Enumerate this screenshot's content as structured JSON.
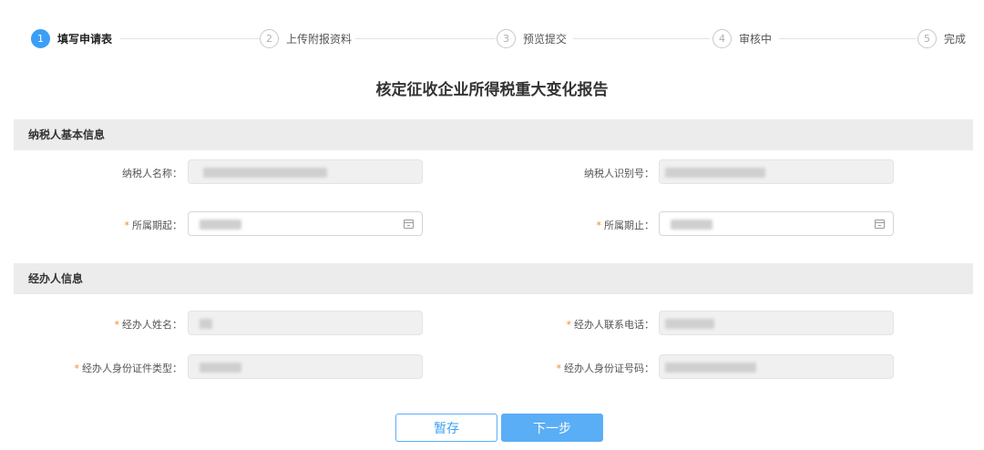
{
  "steps": [
    {
      "num": "1",
      "label": "填写申请表"
    },
    {
      "num": "2",
      "label": "上传附报资料"
    },
    {
      "num": "3",
      "label": "预览提交"
    },
    {
      "num": "4",
      "label": "审核中"
    },
    {
      "num": "5",
      "label": "完成"
    }
  ],
  "title": "核定征收企业所得税重大变化报告",
  "section_taxpayer": {
    "header": "纳税人基本信息",
    "name_label": "纳税人名称：",
    "id_label": "纳税人识别号：",
    "period_start_label": "所属期起：",
    "period_end_label": "所属期止："
  },
  "section_agent": {
    "header": "经办人信息",
    "name_label": "经办人姓名：",
    "phone_label": "经办人联系电话：",
    "id_type_label": "经办人身份证件类型：",
    "id_number_label": "经办人身份证号码："
  },
  "required_mark": "*",
  "buttons": {
    "save": "暂存",
    "next": "下一步"
  }
}
